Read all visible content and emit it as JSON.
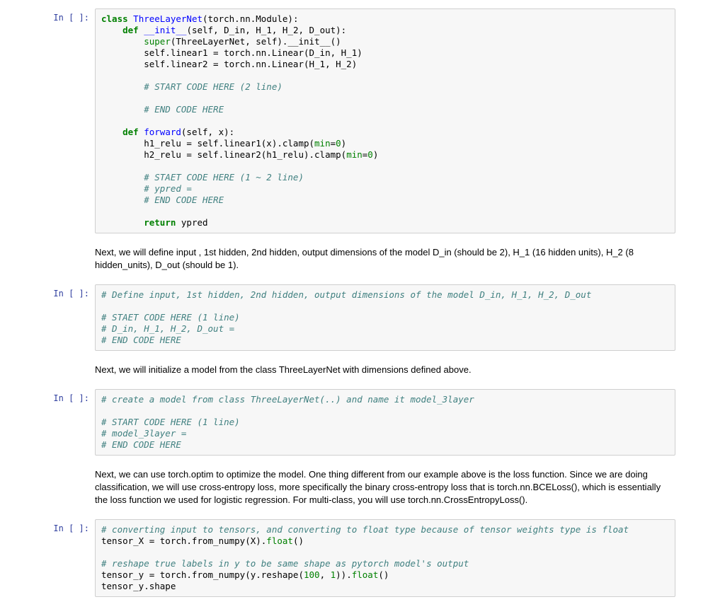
{
  "prompts": {
    "in_empty": "In [ ]:"
  },
  "cells": [
    {
      "id": "cell1",
      "prompt": "In [ ]:",
      "code": {
        "l01a": "class",
        "l01b": " ",
        "l01c": "ThreeLayerNet",
        "l01d": "(torch.nn.Module):",
        "l02a": "    ",
        "l02b": "def",
        "l02c": " ",
        "l02d": "__init__",
        "l02e": "(self, D_in, H_1, H_2, D_out):",
        "l03a": "        ",
        "l03b": "super",
        "l03c": "(ThreeLayerNet, self).",
        "l03d": "__init__",
        "l03e": "()",
        "l04": "        self.linear1 = torch.nn.Linear(D_in, H_1)",
        "l05": "        self.linear2 = torch.nn.Linear(H_1, H_2)",
        "blank": "",
        "l07": "        # START CODE HERE (2 line)",
        "l09": "        # END CODE HERE",
        "l11a": "    ",
        "l11b": "def",
        "l11c": " ",
        "l11d": "forward",
        "l11e": "(self, x):",
        "l12a": "        h1_relu = self.linear1(x).clamp(",
        "l12b": "min",
        "l12c": "=",
        "l12d": "0",
        "l12e": ")",
        "l13a": "        h2_relu = self.linear2(h1_relu).clamp(",
        "l13b": "min",
        "l13c": "=",
        "l13d": "0",
        "l13e": ")",
        "l15": "        # STAET CODE HERE (1 ~ 2 line)",
        "l16": "        # ypred =",
        "l17": "        # END CODE HERE",
        "l19a": "        ",
        "l19b": "return",
        "l19c": " ypred"
      }
    },
    {
      "id": "md1",
      "text": "Next, we will define input , 1st hidden, 2nd hidden, output dimensions of the model D_in (should be 2), H_1 (16 hidden units), H_2 (8 hidden_units), D_out (should be 1)."
    },
    {
      "id": "cell2",
      "prompt": "In [ ]:",
      "code": {
        "l1": "# Define input, 1st hidden, 2nd hidden, output dimensions of the model D_in, H_1, H_2, D_out",
        "blank": "",
        "l3": "# STAET CODE HERE (1 line)",
        "l4": "# D_in, H_1, H_2, D_out =",
        "l5": "# END CODE HERE"
      }
    },
    {
      "id": "md2",
      "text": "Next, we will initialize a model from the class ThreeLayerNet with dimensions defined above."
    },
    {
      "id": "cell3",
      "prompt": "In [ ]:",
      "code": {
        "l1": "# create a model from class ThreeLayerNet(..) and name it model_3layer",
        "blank": "",
        "l3": "# START CODE HERE (1 line)",
        "l4": "# model_3layer =",
        "l5": "# END CODE HERE"
      }
    },
    {
      "id": "md3",
      "text": "Next, we can use torch.optim to optimize the model. One thing different from our example above is the loss function. Since we are doing classification, we will use cross-entropy loss, more specifically the binary cross-entropy loss that is torch.nn.BCELoss(), which is essentially the loss function we used for logistic regression. For multi-class, you will use torch.nn.CrossEntropyLoss()."
    },
    {
      "id": "cell4",
      "prompt": "In [ ]:",
      "code": {
        "l1": "# converting input to tensors, and converting to float type because of tensor weights type is float",
        "l2a": "tensor_X = torch.from_numpy(X).",
        "l2b": "float",
        "l2c": "()",
        "blank": "",
        "l4": "# reshape true labels in y to be same shape as pytorch model's output",
        "l5a": "tensor_y = torch.from_numpy(y.reshape(",
        "l5b": "100",
        "l5c": ", ",
        "l5d": "1",
        "l5e": ")).",
        "l5f": "float",
        "l5g": "()",
        "l6": "tensor_y.shape"
      }
    }
  ]
}
